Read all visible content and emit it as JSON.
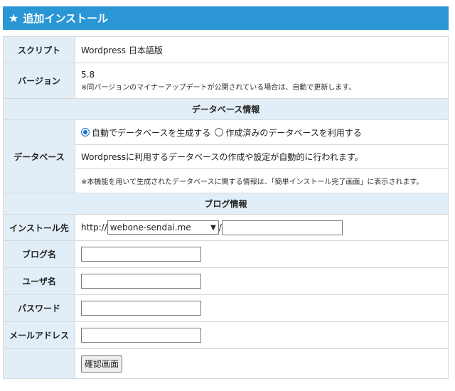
{
  "header": {
    "star_icon": "★",
    "title": "追加インストール"
  },
  "script": {
    "label": "スクリプト",
    "value": "Wordpress 日本語版"
  },
  "version": {
    "label": "バージョン",
    "value": "5.8",
    "note": "※同バージョンのマイナーアップデートが公開されている場合は、自動で更新します。"
  },
  "db_section": {
    "title": "データベース情報"
  },
  "database": {
    "label": "データベース",
    "option_auto": "自動でデータベースを生成する",
    "option_existing": "作成済みのデータベースを利用する",
    "selected": "auto",
    "description": "Wordpressに利用するデータベースの作成や設定が自動的に行われます。",
    "note": "※本機能を用いて生成されたデータベースに関する情報は、「簡単インストール完了画面」に表示されます。"
  },
  "blog_section": {
    "title": "ブログ情報"
  },
  "install_dest": {
    "label": "インストール先",
    "prefix": "http://",
    "domain": "webone-sendai.me",
    "separator": "/",
    "path": ""
  },
  "blog_name": {
    "label": "ブログ名",
    "value": ""
  },
  "username": {
    "label": "ユーザ名",
    "value": ""
  },
  "password": {
    "label": "パスワード",
    "value": ""
  },
  "email": {
    "label": "メールアドレス",
    "value": ""
  },
  "confirm": {
    "label": "確認画面"
  },
  "colors": {
    "header_bg": "#2b96d4",
    "label_bg": "#e2eef7"
  }
}
